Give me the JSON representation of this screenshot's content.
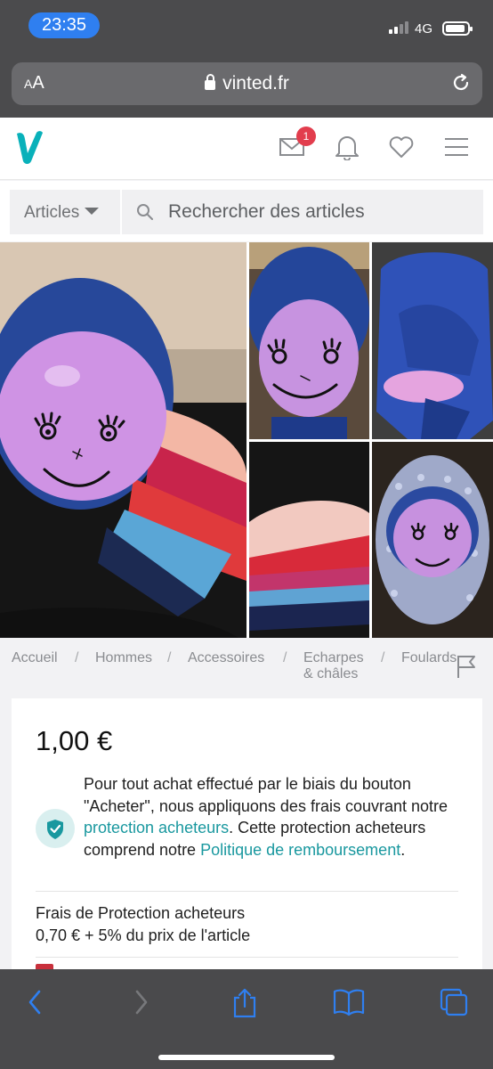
{
  "status_bar": {
    "time": "23:35",
    "network": "4G"
  },
  "browser": {
    "text_size_label_small": "A",
    "text_size_label_large": "A",
    "url": "vinted.fr"
  },
  "header": {
    "messages_badge": "1"
  },
  "search": {
    "category_label": "Articles",
    "placeholder": "Rechercher des articles"
  },
  "breadcrumb": {
    "items": [
      "Accueil",
      "Hommes",
      "Accessoires",
      "Echarpes",
      "& châles",
      "Foulards"
    ],
    "separator": "/"
  },
  "item": {
    "price": "1,00 €",
    "protection_text_1": "Pour tout achat effectué par le biais du bouton \"Acheter\", nous appliquons des frais couvrant notre ",
    "protection_link_1": "protection acheteurs",
    "protection_text_2": ". Cette protection acheteurs comprend notre ",
    "protection_link_2": "Politique de remboursement",
    "protection_text_3": ".",
    "fees_title": "Frais de Protection acheteurs",
    "fees_value": "0,70 € + 5% du prix de l'article"
  },
  "colors": {
    "brand": "#09b1ba",
    "link": "#19989f",
    "badge": "#e23d4d",
    "browser_chrome": "#4b4b4d",
    "toolbar_icons": "#2f7ff0"
  },
  "icons": [
    "lock-icon",
    "reload-icon",
    "vinted-logo",
    "mail-icon",
    "bell-icon",
    "heart-icon",
    "menu-icon",
    "search-icon",
    "flag-icon",
    "shield-check-icon",
    "back-icon",
    "forward-icon",
    "share-icon",
    "bookmarks-icon",
    "tabs-icon"
  ]
}
